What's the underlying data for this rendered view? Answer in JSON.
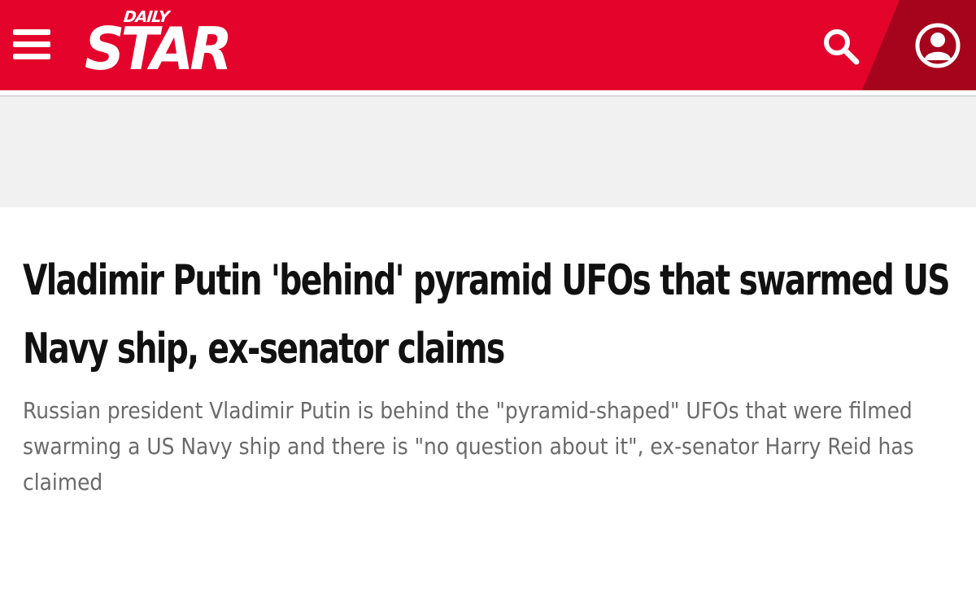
{
  "header": {
    "brand": {
      "small": "DAILY",
      "main": "STAR"
    },
    "icons": {
      "menu": "hamburger-menu-icon",
      "search": "search-icon",
      "account": "user-account-icon"
    },
    "colors": {
      "brand_red": "#e4032b",
      "dark_red": "#a5041c",
      "white": "#ffffff"
    }
  },
  "ad": {
    "background": "#f1f1f1"
  },
  "article": {
    "headline": "Vladimir Putin 'behind' pyramid UFOs that swarmed US Navy ship, ex-senator claims",
    "standfirst": "Russian president Vladimir Putin is behind the \"pyramid-shaped\" UFOs that were filmed swarming a US Navy ship and there is \"no question about it\", ex-senator Harry Reid has claimed",
    "colors": {
      "headline": "#111111",
      "standfirst": "#6a6a6a"
    }
  }
}
